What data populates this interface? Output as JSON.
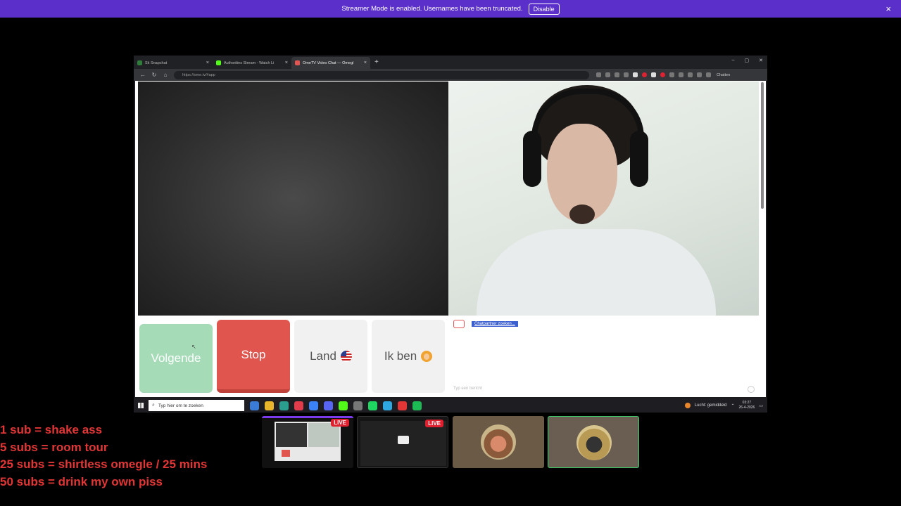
{
  "banner": {
    "message": "Streamer Mode is enabled. Usernames have been truncated.",
    "disable_label": "Disable",
    "close_icon": "×"
  },
  "browser": {
    "tabs": [
      {
        "title": "Sk Snapchat",
        "icon_color": "#2f7d3a"
      },
      {
        "title": "Authorities Stream - Watch Li",
        "icon_color": "#53fc18"
      },
      {
        "title": "OmeTV Video Chat — Omegl",
        "icon_color": "#e25555"
      }
    ],
    "new_tab_icon": "+",
    "window_controls": [
      "–",
      "▢",
      "✕"
    ],
    "url": "https://ome.tv/#app",
    "nav_icons": [
      "←",
      "↻",
      "⌂"
    ],
    "copilot_label": "Chatten"
  },
  "ometv": {
    "buttons": {
      "next": "Volgende",
      "stop": "Stop",
      "country": "Land",
      "i_am": "Ik ben"
    },
    "chat_status": "Chatpartner zoeken...",
    "chat_placeholder": "Typ een bericht"
  },
  "taskbar": {
    "search_placeholder": "Typ hier om te zoeken",
    "weather": "Lucht: gemiddeld",
    "time": "03:27",
    "date": "26-4-2026",
    "apps": [
      "#3a7bd5",
      "#e8b52b",
      "#2a9d8f",
      "#e23b4b",
      "#3b82f6",
      "#5865f2",
      "#53fc18",
      "#777777",
      "#1ed760",
      "#2ea7e0",
      "#e23636",
      "#1db954"
    ]
  },
  "goals": [
    "1 sub = shake ass",
    "5 subs = room tour",
    "25 subs = shirtless omegle / 25 mins",
    "50 subs = drink my own piss"
  ],
  "thumbnails": {
    "live_label": "LIVE"
  }
}
